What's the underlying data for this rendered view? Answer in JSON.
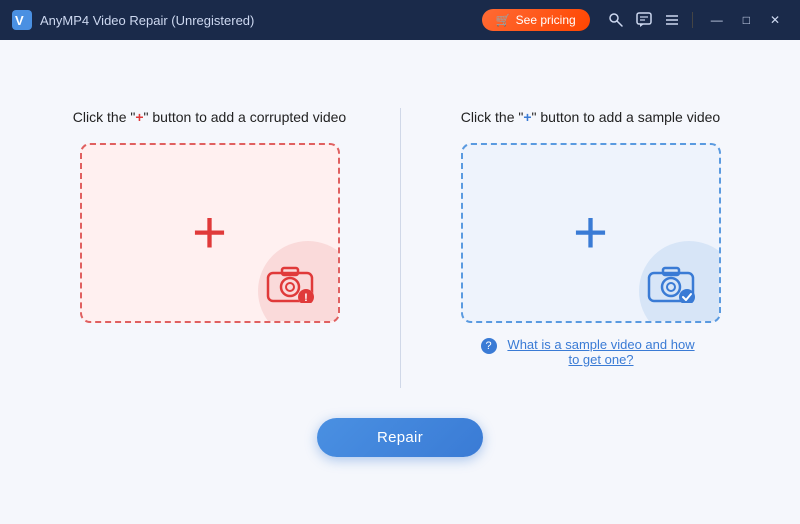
{
  "titleBar": {
    "logo": "anymp4-logo",
    "title": "AnyMP4 Video Repair (Unregistered)",
    "pricingLabel": "See pricing",
    "pricingIcon": "🛒",
    "iconSearch": "🔑",
    "iconChat": "💬",
    "iconMenu": "☰",
    "btnMinimize": "—",
    "btnMaximize": "□",
    "btnClose": "✕"
  },
  "leftPanel": {
    "instructionPrefix": "Click the \"",
    "plusSymbol": "+",
    "instructionSuffix": "\" button to add a corrupted video",
    "dropZoneAriaLabel": "Add corrupted video drop zone"
  },
  "rightPanel": {
    "instructionPrefix": "Click the \"",
    "plusSymbol": "+",
    "instructionSuffix": "\" button to add a sample video",
    "helpIcon": "?",
    "helpText": "What is a sample video and how to get one?",
    "dropZoneAriaLabel": "Add sample video drop zone"
  },
  "footer": {
    "repairLabel": "Repair"
  },
  "colors": {
    "red": "#e03a3a",
    "blue": "#3a7bd5",
    "redBg": "#fff0f0",
    "blueBg": "#eef3fc"
  }
}
